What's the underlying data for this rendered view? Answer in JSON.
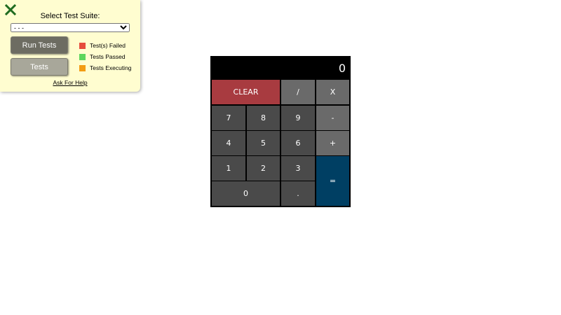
{
  "test_panel": {
    "title": "Select Test Suite:",
    "suite_select": {
      "selected": "- - -",
      "options": [
        "- - -"
      ]
    },
    "run_button_label": "Run Tests",
    "tests_button_label": "Tests",
    "legend": [
      {
        "label": "Test(s) Failed",
        "color": "#e64c3c"
      },
      {
        "label": "Tests Passed",
        "color": "#5cd65c"
      },
      {
        "label": "Tests Executing",
        "color": "#f39c12"
      }
    ],
    "help_link": "Ask For Help",
    "close_icon": "close-icon",
    "close_color": "#1f6b1f"
  },
  "calculator": {
    "display_value": "0",
    "keys": {
      "clear": "CLEAR",
      "divide": "/",
      "multiply": "X",
      "seven": "7",
      "eight": "8",
      "nine": "9",
      "minus": "-",
      "four": "4",
      "five": "5",
      "six": "6",
      "plus": "+",
      "one": "1",
      "two": "2",
      "three": "3",
      "equals": "=",
      "zero": "0",
      "decimal": "."
    },
    "colors": {
      "clear": "#a83b40",
      "equals": "#003f63",
      "number": "#4a4a4a",
      "operator": "#6a6a6a"
    }
  }
}
